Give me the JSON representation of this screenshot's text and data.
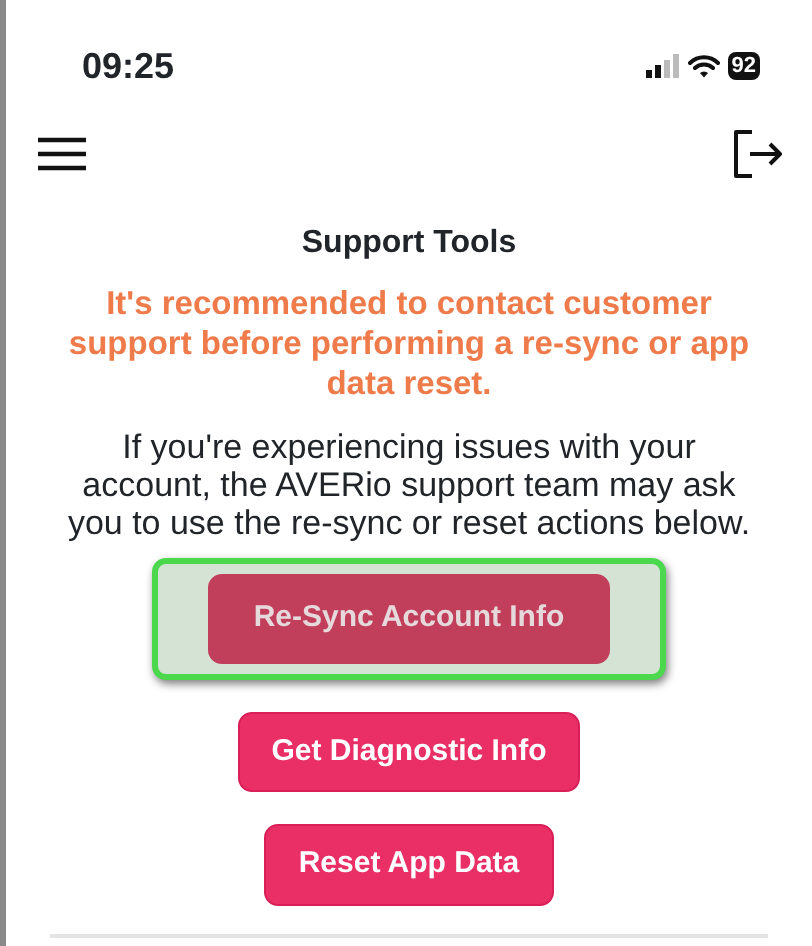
{
  "status_bar": {
    "time": "09:25",
    "battery": "92"
  },
  "page": {
    "title": "Support Tools",
    "warning": "It's recommended to contact customer support before performing a re-sync or app data reset.",
    "description": "If you're experiencing issues with your account, the AVERio support team may ask you to use the re-sync or reset actions below."
  },
  "buttons": [
    {
      "label": "Re-Sync Account Info",
      "highlighted": true
    },
    {
      "label": "Get Diagnostic Info",
      "highlighted": false
    },
    {
      "label": "Reset App Data",
      "highlighted": false
    }
  ]
}
